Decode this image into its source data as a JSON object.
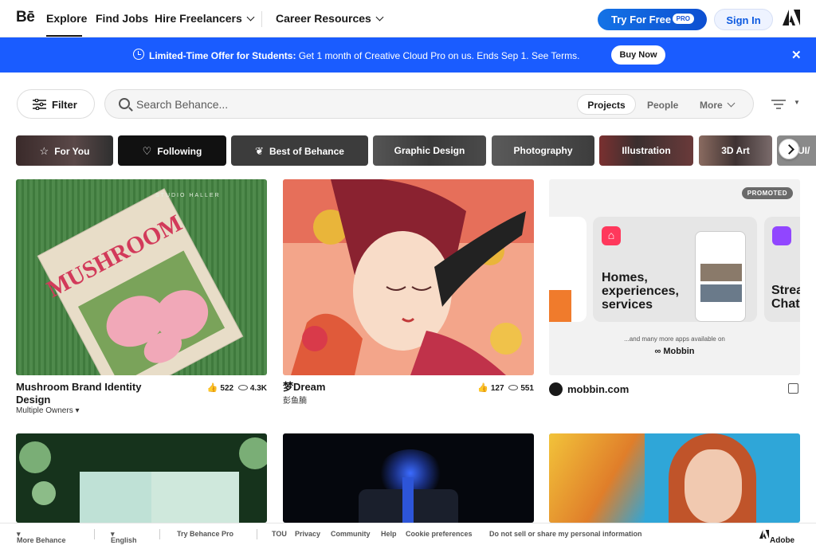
{
  "nav": {
    "logo": "Bē",
    "items": [
      "Explore",
      "Find Jobs",
      "Hire Freelancers",
      "Career Resources"
    ],
    "try_label": "Try For Free",
    "pro_badge": "PRO",
    "signin_label": "Sign In"
  },
  "promo": {
    "bold_text": "Limited-Time Offer for Students:",
    "text": " Get 1 month of Creative Cloud Pro on us. Ends Sep 1. See Terms.",
    "button": "Buy Now",
    "close": "✕"
  },
  "search": {
    "filter_label": "Filter",
    "placeholder": "Search Behance...",
    "segments": [
      "Projects",
      "People",
      "More"
    ]
  },
  "categories": [
    {
      "label": "For You",
      "icon": "star-icon"
    },
    {
      "label": "Following",
      "icon": "heart-icon"
    },
    {
      "label": "Best of Behance",
      "icon": "laurel-icon"
    },
    {
      "label": "Graphic Design"
    },
    {
      "label": "Photography"
    },
    {
      "label": "Illustration"
    },
    {
      "label": "3D Art"
    },
    {
      "label": "UI/"
    }
  ],
  "cards": [
    {
      "title": "Mushroom Brand Identity Design",
      "owner": "Multiple Owners",
      "likes": "522",
      "views": "4.3K",
      "art": {
        "cover_title": "MUSHROOM",
        "cover_tag": "STUDIO HALLER"
      }
    },
    {
      "title": "梦Dream",
      "owner": "彭鱼腩",
      "likes": "127",
      "views": "551"
    },
    {
      "title": "mobbin.com",
      "badge": "PROMOTED",
      "ad": {
        "headline": "Homes, experiences, services",
        "side_text": "Strea Chat",
        "caption": "...and many more apps available on",
        "brand": "Mobbin"
      }
    }
  ],
  "second_row": [
    {
      "art": "business cards"
    },
    {
      "art": "race car"
    },
    {
      "art": "portrait"
    }
  ],
  "footer": {
    "more": "More Behance",
    "lang": "English",
    "try_pro": "Try Behance Pro",
    "links": [
      "TOU",
      "Privacy",
      "Community",
      "Help",
      "Cookie preferences",
      "Do not sell or share my personal information"
    ],
    "brand": "Adobe"
  }
}
